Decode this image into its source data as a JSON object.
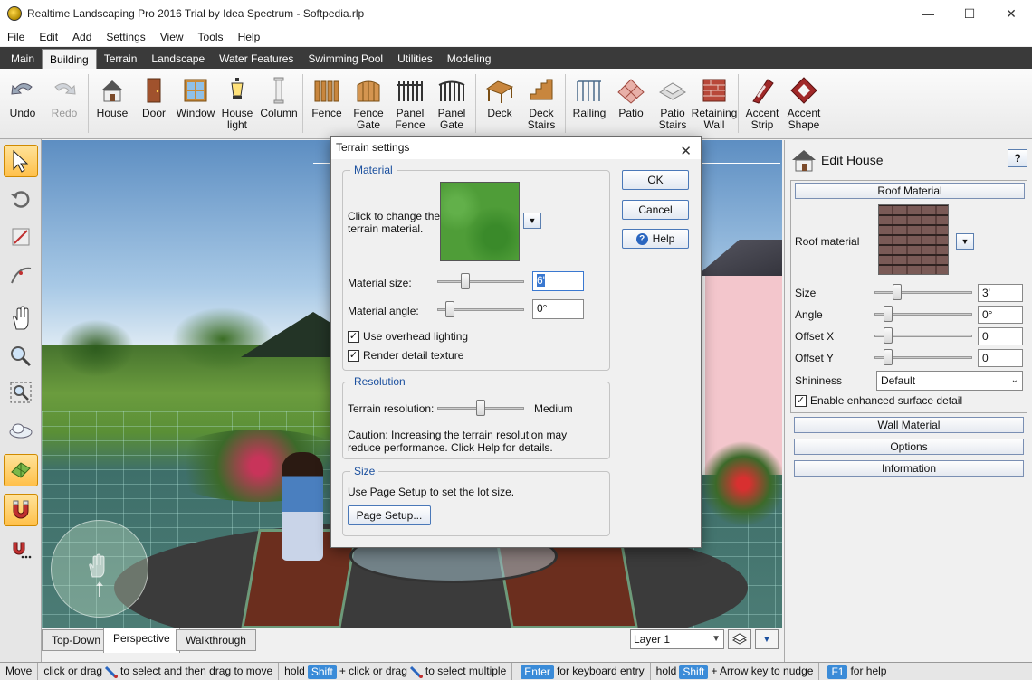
{
  "window": {
    "title": "Realtime Landscaping Pro 2016 Trial by Idea Spectrum - Softpedia.rlp"
  },
  "menu": [
    "File",
    "Edit",
    "Add",
    "Settings",
    "View",
    "Tools",
    "Help"
  ],
  "tabs": [
    "Main",
    "Building",
    "Terrain",
    "Landscape",
    "Water Features",
    "Swimming Pool",
    "Utilities",
    "Modeling"
  ],
  "active_tab": "Building",
  "toolbar": {
    "undo": "Undo",
    "redo": "Redo",
    "house": "House",
    "door": "Door",
    "window": "Window",
    "house_light_1": "House",
    "house_light_2": "light",
    "column": "Column",
    "fence": "Fence",
    "fence_gate_1": "Fence",
    "fence_gate_2": "Gate",
    "panel_fence_1": "Panel",
    "panel_fence_2": "Fence",
    "panel_gate_1": "Panel",
    "panel_gate_2": "Gate",
    "deck": "Deck",
    "deck_stairs_1": "Deck",
    "deck_stairs_2": "Stairs",
    "railing": "Railing",
    "patio": "Patio",
    "patio_stairs_1": "Patio",
    "patio_stairs_2": "Stairs",
    "retaining_wall_1": "Retaining",
    "retaining_wall_2": "Wall",
    "accent_strip_1": "Accent",
    "accent_strip_2": "Strip",
    "accent_shape_1": "Accent",
    "accent_shape_2": "Shape"
  },
  "viewtabs": {
    "topdown": "Top-Down",
    "perspective": "Perspective",
    "walkthrough": "Walkthrough",
    "layer": "Layer 1"
  },
  "dialog": {
    "title": "Terrain settings",
    "material_legend": "Material",
    "material_hint": "Click to change the terrain material.",
    "size_label": "Material size:",
    "size_value": "6'",
    "angle_label": "Material angle:",
    "angle_value": "0°",
    "use_overhead": "Use overhead lighting",
    "render_detail": "Render detail texture",
    "resolution_legend": "Resolution",
    "terrain_res_label": "Terrain resolution:",
    "terrain_res_value": "Medium",
    "caution": "Caution: Increasing the terrain resolution may reduce performance. Click Help for details.",
    "size_legend": "Size",
    "size_hint": "Use Page Setup to set the lot size.",
    "page_setup": "Page Setup...",
    "ok": "OK",
    "cancel": "Cancel",
    "help": "Help",
    "material_size_slider": 0.3,
    "material_angle_slider": 0.1,
    "terrain_res_slider": 0.5
  },
  "panel": {
    "title": "Edit House",
    "help": "?",
    "roof_material_btn": "Roof Material",
    "roof_material_label": "Roof material",
    "size_label": "Size",
    "size_value": "3'",
    "angle_label": "Angle",
    "angle_value": "0°",
    "offx_label": "Offset X",
    "offx_value": "0",
    "offy_label": "Offset Y",
    "offy_value": "0",
    "shininess_label": "Shininess",
    "shininess_value": "Default",
    "enhanced": "Enable enhanced surface detail",
    "wall_material": "Wall Material",
    "options": "Options",
    "information": "Information",
    "size_slider": 0.2,
    "angle_slider": 0.1,
    "offx_slider": 0.1,
    "offy_slider": 0.1
  },
  "status": {
    "mode": "Move",
    "s1a": "click or drag",
    "s1b": "to select and then drag to move",
    "s2a": "hold",
    "k_shift": "Shift",
    "s2b": "+ click or drag",
    "s2c": "to select multiple",
    "k_enter": "Enter",
    "s3": "for keyboard entry",
    "s4a": "hold",
    "k_shift2": "Shift",
    "s4b": "+ Arrow key to nudge",
    "k_f1": "F1",
    "s5": "for help"
  }
}
